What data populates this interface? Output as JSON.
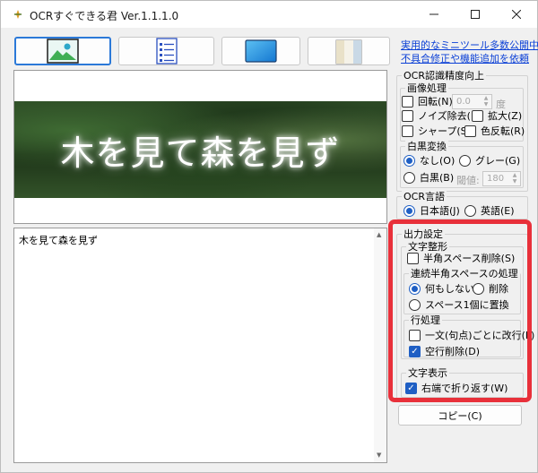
{
  "window": {
    "title": "OCRすぐできる君 Ver.1.1.1.0"
  },
  "icons": {
    "app": "app-icon",
    "minimize": "minimize-icon",
    "maximize": "maximize-icon",
    "close": "close-icon",
    "image": "image-icon",
    "text": "text-list-icon",
    "screen": "screen-capture-icon",
    "window": "window-capture-icon"
  },
  "links": {
    "first": "実用的なミニツール多数公開中",
    "second": "不具合修正や機能追加を依頼"
  },
  "preview": {
    "banner_text": "木を見て森を見ず"
  },
  "result": {
    "text": "木を見て森を見ず"
  },
  "ocr_precision": {
    "title": "OCR認識精度向上",
    "image_processing": {
      "title": "画像処理",
      "rotate": "回転(N)",
      "rotate_value": "0.0",
      "rotate_unit": "度",
      "denoise": "ノイズ除去(N)",
      "enlarge": "拡大(Z)",
      "sharpen": "シャープ(S)",
      "invert": "色反転(R)"
    },
    "bw": {
      "title": "白黒変換",
      "none": "なし(O)",
      "gray": "グレー(G)",
      "bw": "白黒(B)",
      "threshold_label": "閾値:",
      "threshold_value": "180"
    }
  },
  "ocr_language": {
    "title": "OCR言語",
    "japanese": "日本語(J)",
    "english": "英語(E)"
  },
  "output": {
    "title": "出力設定",
    "formatting": {
      "title": "文字整形",
      "remove_halfwidth_space": "半角スペース削除(S)",
      "consecutive": {
        "title": "連続半角スペースの処理",
        "do_nothing": "何もしない",
        "delete": "削除",
        "replace_one": "スペース1個に置換"
      },
      "line": {
        "title": "行処理",
        "break_each_sentence": "一文(句点)ごとに改行(L)",
        "delete_blank": "空行削除(D)"
      }
    },
    "display": {
      "title": "文字表示",
      "wrap": "右端で折り返す(W)"
    }
  },
  "buttons": {
    "copy": "コピー(C)"
  },
  "colors": {
    "accent": "#1f5fc4",
    "highlight": "#e8303a",
    "link": "#0a3fd6"
  }
}
